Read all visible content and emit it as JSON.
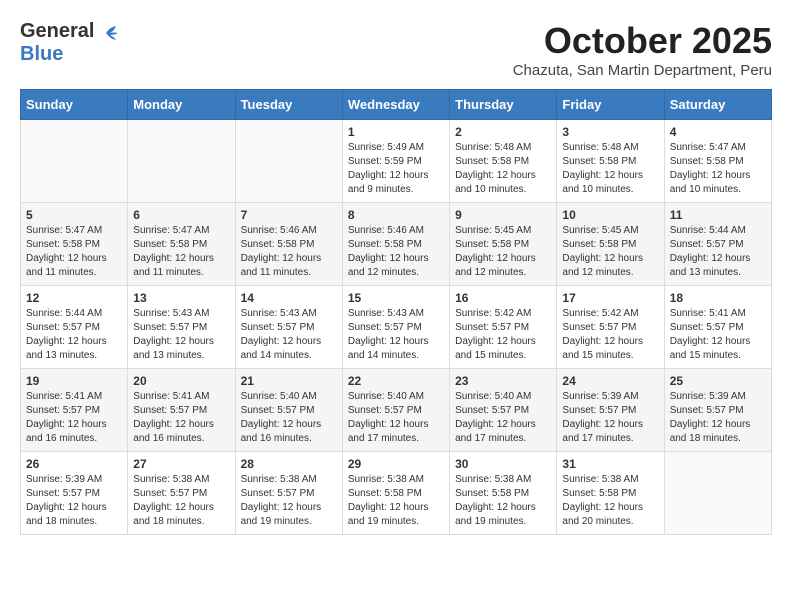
{
  "header": {
    "logo_general": "General",
    "logo_blue": "Blue",
    "month_title": "October 2025",
    "subtitle": "Chazuta, San Martin Department, Peru"
  },
  "days_of_week": [
    "Sunday",
    "Monday",
    "Tuesday",
    "Wednesday",
    "Thursday",
    "Friday",
    "Saturday"
  ],
  "weeks": [
    [
      {
        "day": "",
        "info": ""
      },
      {
        "day": "",
        "info": ""
      },
      {
        "day": "",
        "info": ""
      },
      {
        "day": "1",
        "info": "Sunrise: 5:49 AM\nSunset: 5:59 PM\nDaylight: 12 hours\nand 9 minutes."
      },
      {
        "day": "2",
        "info": "Sunrise: 5:48 AM\nSunset: 5:58 PM\nDaylight: 12 hours\nand 10 minutes."
      },
      {
        "day": "3",
        "info": "Sunrise: 5:48 AM\nSunset: 5:58 PM\nDaylight: 12 hours\nand 10 minutes."
      },
      {
        "day": "4",
        "info": "Sunrise: 5:47 AM\nSunset: 5:58 PM\nDaylight: 12 hours\nand 10 minutes."
      }
    ],
    [
      {
        "day": "5",
        "info": "Sunrise: 5:47 AM\nSunset: 5:58 PM\nDaylight: 12 hours\nand 11 minutes."
      },
      {
        "day": "6",
        "info": "Sunrise: 5:47 AM\nSunset: 5:58 PM\nDaylight: 12 hours\nand 11 minutes."
      },
      {
        "day": "7",
        "info": "Sunrise: 5:46 AM\nSunset: 5:58 PM\nDaylight: 12 hours\nand 11 minutes."
      },
      {
        "day": "8",
        "info": "Sunrise: 5:46 AM\nSunset: 5:58 PM\nDaylight: 12 hours\nand 12 minutes."
      },
      {
        "day": "9",
        "info": "Sunrise: 5:45 AM\nSunset: 5:58 PM\nDaylight: 12 hours\nand 12 minutes."
      },
      {
        "day": "10",
        "info": "Sunrise: 5:45 AM\nSunset: 5:58 PM\nDaylight: 12 hours\nand 12 minutes."
      },
      {
        "day": "11",
        "info": "Sunrise: 5:44 AM\nSunset: 5:57 PM\nDaylight: 12 hours\nand 13 minutes."
      }
    ],
    [
      {
        "day": "12",
        "info": "Sunrise: 5:44 AM\nSunset: 5:57 PM\nDaylight: 12 hours\nand 13 minutes."
      },
      {
        "day": "13",
        "info": "Sunrise: 5:43 AM\nSunset: 5:57 PM\nDaylight: 12 hours\nand 13 minutes."
      },
      {
        "day": "14",
        "info": "Sunrise: 5:43 AM\nSunset: 5:57 PM\nDaylight: 12 hours\nand 14 minutes."
      },
      {
        "day": "15",
        "info": "Sunrise: 5:43 AM\nSunset: 5:57 PM\nDaylight: 12 hours\nand 14 minutes."
      },
      {
        "day": "16",
        "info": "Sunrise: 5:42 AM\nSunset: 5:57 PM\nDaylight: 12 hours\nand 15 minutes."
      },
      {
        "day": "17",
        "info": "Sunrise: 5:42 AM\nSunset: 5:57 PM\nDaylight: 12 hours\nand 15 minutes."
      },
      {
        "day": "18",
        "info": "Sunrise: 5:41 AM\nSunset: 5:57 PM\nDaylight: 12 hours\nand 15 minutes."
      }
    ],
    [
      {
        "day": "19",
        "info": "Sunrise: 5:41 AM\nSunset: 5:57 PM\nDaylight: 12 hours\nand 16 minutes."
      },
      {
        "day": "20",
        "info": "Sunrise: 5:41 AM\nSunset: 5:57 PM\nDaylight: 12 hours\nand 16 minutes."
      },
      {
        "day": "21",
        "info": "Sunrise: 5:40 AM\nSunset: 5:57 PM\nDaylight: 12 hours\nand 16 minutes."
      },
      {
        "day": "22",
        "info": "Sunrise: 5:40 AM\nSunset: 5:57 PM\nDaylight: 12 hours\nand 17 minutes."
      },
      {
        "day": "23",
        "info": "Sunrise: 5:40 AM\nSunset: 5:57 PM\nDaylight: 12 hours\nand 17 minutes."
      },
      {
        "day": "24",
        "info": "Sunrise: 5:39 AM\nSunset: 5:57 PM\nDaylight: 12 hours\nand 17 minutes."
      },
      {
        "day": "25",
        "info": "Sunrise: 5:39 AM\nSunset: 5:57 PM\nDaylight: 12 hours\nand 18 minutes."
      }
    ],
    [
      {
        "day": "26",
        "info": "Sunrise: 5:39 AM\nSunset: 5:57 PM\nDaylight: 12 hours\nand 18 minutes."
      },
      {
        "day": "27",
        "info": "Sunrise: 5:38 AM\nSunset: 5:57 PM\nDaylight: 12 hours\nand 18 minutes."
      },
      {
        "day": "28",
        "info": "Sunrise: 5:38 AM\nSunset: 5:57 PM\nDaylight: 12 hours\nand 19 minutes."
      },
      {
        "day": "29",
        "info": "Sunrise: 5:38 AM\nSunset: 5:58 PM\nDaylight: 12 hours\nand 19 minutes."
      },
      {
        "day": "30",
        "info": "Sunrise: 5:38 AM\nSunset: 5:58 PM\nDaylight: 12 hours\nand 19 minutes."
      },
      {
        "day": "31",
        "info": "Sunrise: 5:38 AM\nSunset: 5:58 PM\nDaylight: 12 hours\nand 20 minutes."
      },
      {
        "day": "",
        "info": ""
      }
    ]
  ]
}
